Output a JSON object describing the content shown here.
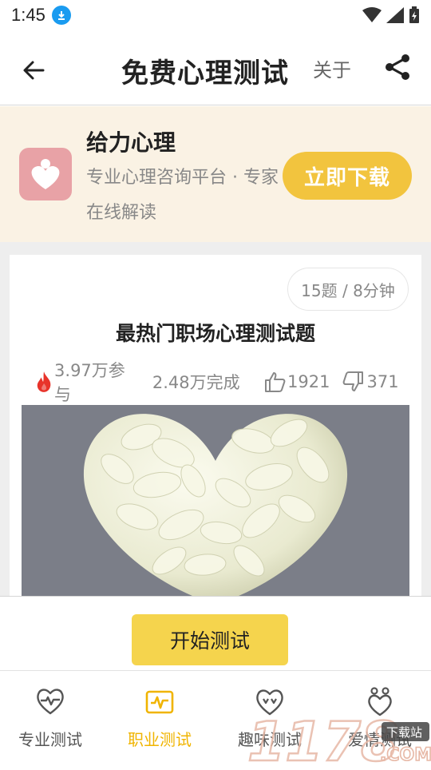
{
  "status_bar": {
    "time": "1:45"
  },
  "header": {
    "title": "免费心理测试",
    "about": "关于"
  },
  "promo": {
    "app_name": "给力心理",
    "description": "专业心理咨询平台 · 专家在线解读",
    "download_label": "立即下载"
  },
  "test": {
    "meta": "15题 / 8分钟",
    "title": "最热门职场心理测试题",
    "participants": "3.97万参与",
    "completed": "2.48万完成",
    "likes": "1921",
    "dislikes": "371"
  },
  "start_label": "开始测试",
  "nav": {
    "items": [
      {
        "label": "专业测试",
        "icon": "heart-pulse-icon"
      },
      {
        "label": "职业测试",
        "icon": "briefcase-chart-icon"
      },
      {
        "label": "趣味测试",
        "icon": "fun-heart-icon"
      },
      {
        "label": "爱情测试",
        "icon": "couple-heart-icon"
      }
    ],
    "active_index": 1
  },
  "watermark": {
    "text": "1178",
    "sub": "下载站",
    "domain": ".COM"
  },
  "colors": {
    "accent": "#f0b400",
    "download": "#f2c43e",
    "start": "#f5d44d",
    "promo_bg": "#faf2e4"
  }
}
